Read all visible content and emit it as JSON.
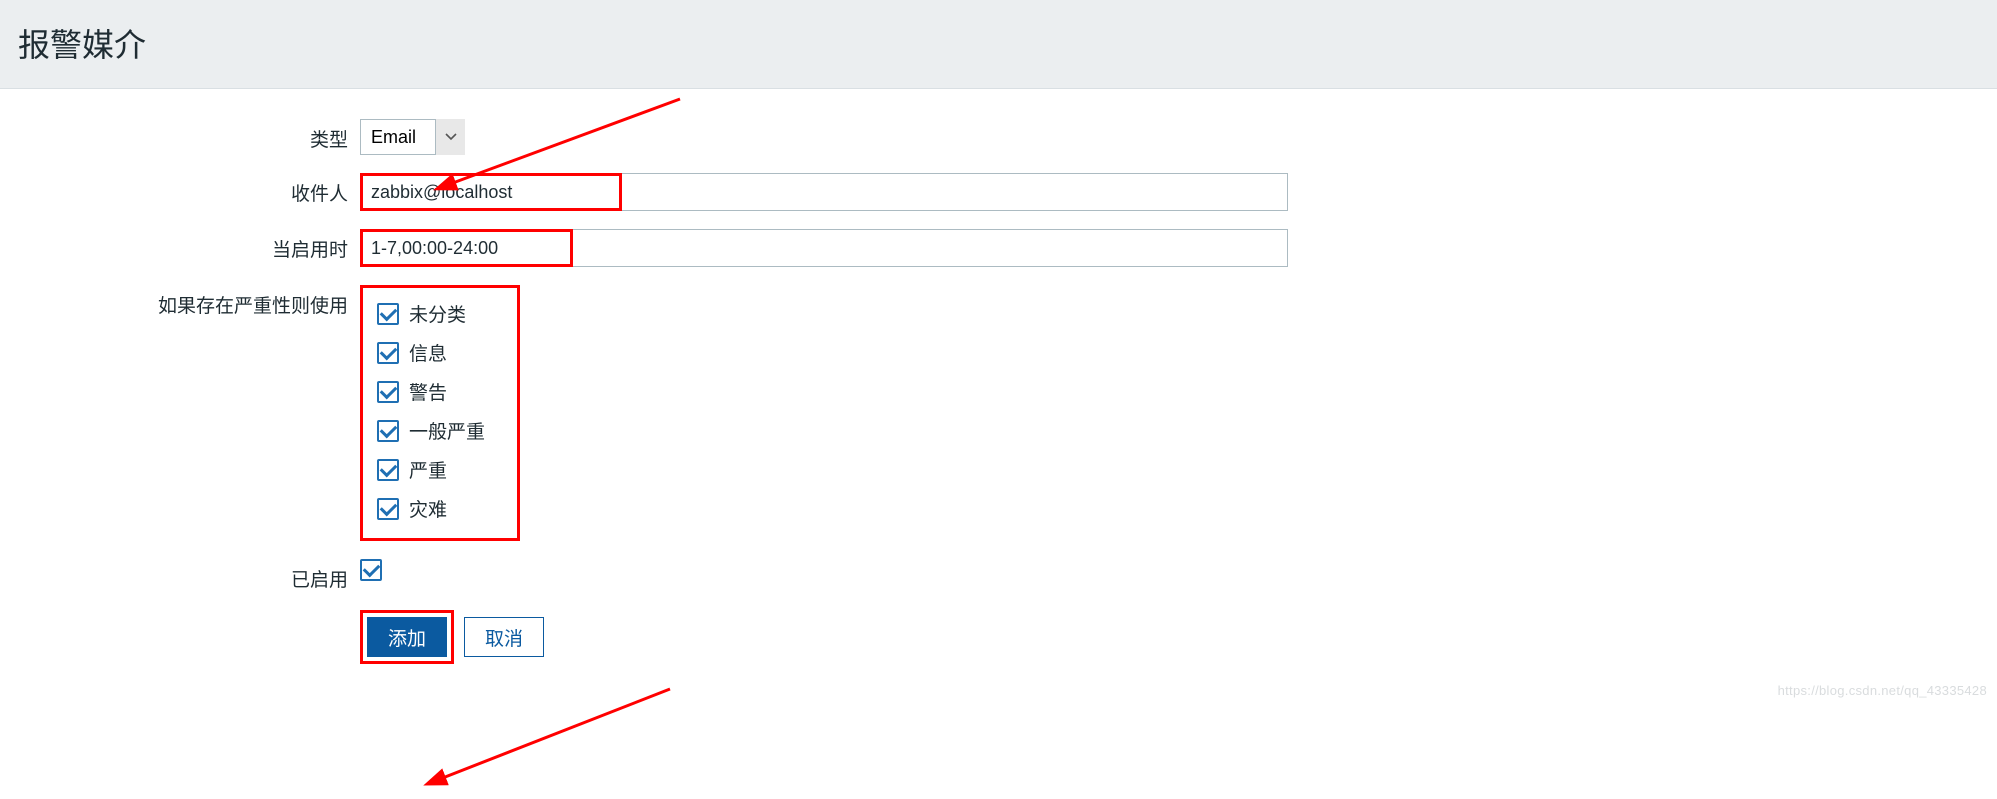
{
  "header": {
    "title": "报警媒介"
  },
  "form": {
    "type_label": "类型",
    "type_value": "Email",
    "recipient_label": "收件人",
    "recipient_value": "zabbix@localhost",
    "active_label": "当启用时",
    "active_value": "1-7,00:00-24:00",
    "severity_label": "如果存在严重性则使用",
    "severities": [
      {
        "label": "未分类",
        "checked": true
      },
      {
        "label": "信息",
        "checked": true
      },
      {
        "label": "警告",
        "checked": true
      },
      {
        "label": "一般严重",
        "checked": true
      },
      {
        "label": "严重",
        "checked": true
      },
      {
        "label": "灾难",
        "checked": true
      }
    ],
    "enabled_label": "已启用",
    "enabled_checked": true,
    "add_button": "添加",
    "cancel_button": "取消"
  },
  "watermark": "https://blog.csdn.net/qq_43335428"
}
